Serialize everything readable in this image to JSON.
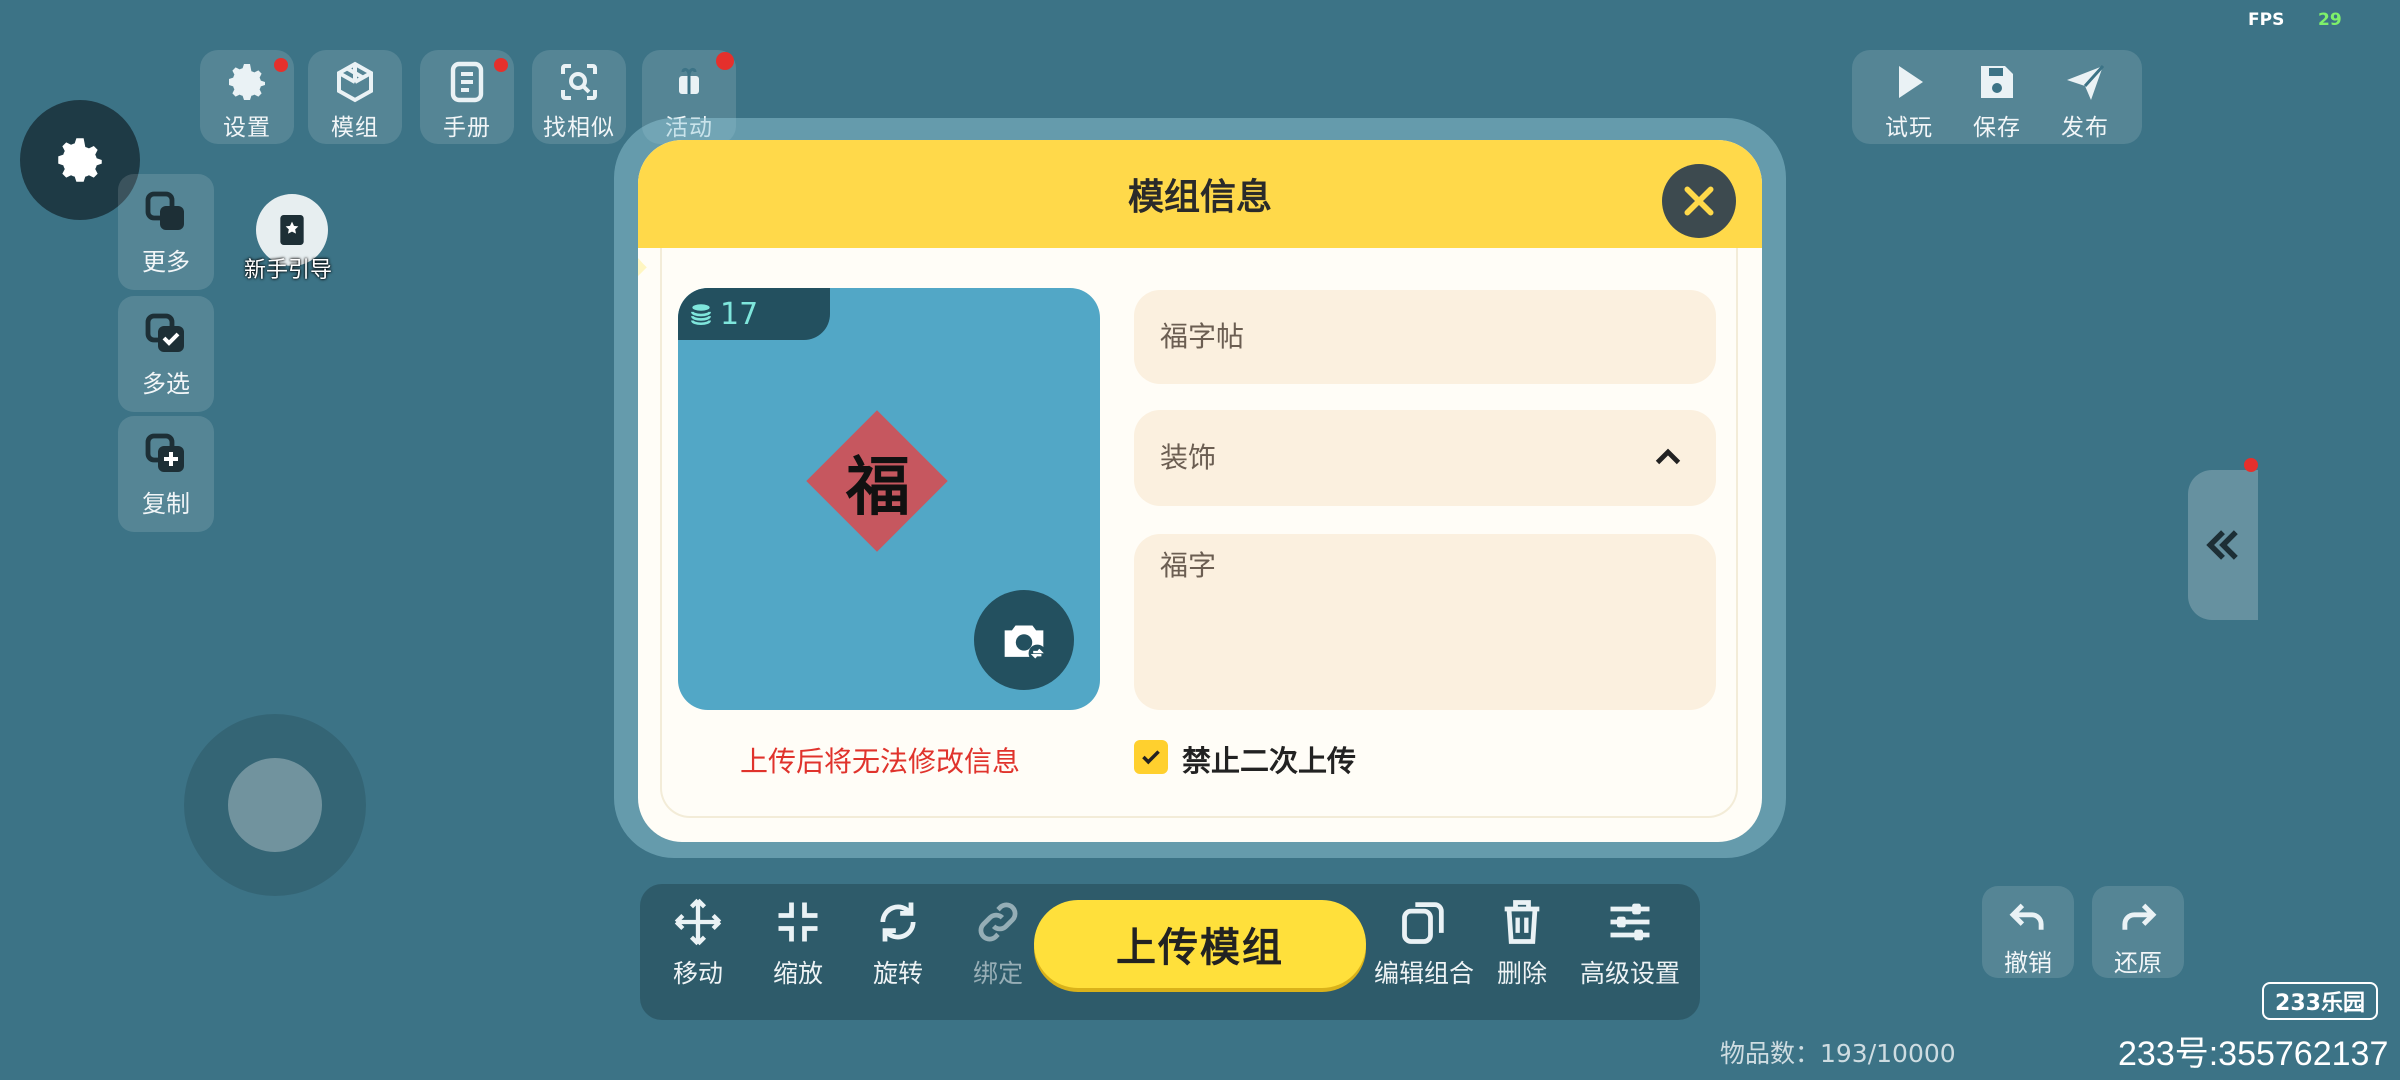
{
  "hud": {
    "fps_label": "FPS",
    "fps_value": "29"
  },
  "top_toolbar": [
    {
      "label": "设置",
      "icon": "gear-icon",
      "badge": true
    },
    {
      "label": "模组",
      "icon": "cube-icon",
      "badge": false
    },
    {
      "label": "手册",
      "icon": "manual-icon",
      "badge": true
    },
    {
      "label": "找相似",
      "icon": "scan-search-icon",
      "badge": false
    },
    {
      "label": "活动",
      "icon": "gift-icon",
      "badge": true
    }
  ],
  "top_right_toolbar": [
    {
      "label": "试玩",
      "icon": "play-icon"
    },
    {
      "label": "保存",
      "icon": "save-icon"
    },
    {
      "label": "发布",
      "icon": "send-icon"
    }
  ],
  "side_menu": [
    {
      "label": "更多",
      "icon": "layers-icon"
    },
    {
      "label": "多选",
      "icon": "multi-select-icon"
    },
    {
      "label": "复制",
      "icon": "duplicate-icon"
    }
  ],
  "guide": {
    "label": "新手引导"
  },
  "undo": {
    "label": "撤销"
  },
  "redo": {
    "label": "还原"
  },
  "bottom_toolbar": {
    "left": [
      {
        "label": "移动",
        "icon": "move-icon"
      },
      {
        "label": "缩放",
        "icon": "scale-icon"
      },
      {
        "label": "旋转",
        "icon": "rotate-icon"
      },
      {
        "label": "绑定",
        "icon": "link-icon"
      }
    ],
    "right": [
      {
        "label": "编辑组合",
        "icon": "copy-group-icon"
      },
      {
        "label": "删除",
        "icon": "trash-icon"
      },
      {
        "label": "高级设置",
        "icon": "sliders-icon"
      }
    ]
  },
  "upload_button": "上传模组",
  "item_count": "物品数：193/10000",
  "watermark": {
    "brand": "233乐园",
    "uid": "233号:355762137"
  },
  "modal": {
    "title": "模组信息",
    "cost": "17",
    "preview_glyph": "福",
    "name_value": "福字帖",
    "category_value": "装饰",
    "description_value": "福字",
    "warning": "上传后将无法修改信息",
    "no_reupload_label": "禁止二次上传",
    "no_reupload_checked": true
  },
  "colors": {
    "accent_yellow": "#ffd94a",
    "warning_red": "#e0332c",
    "scene_bg": "#3c7386"
  }
}
